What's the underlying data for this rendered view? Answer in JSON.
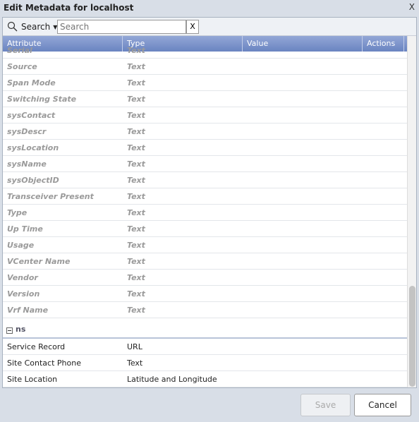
{
  "dialog": {
    "title": "Edit Metadata for localhost",
    "close": "X"
  },
  "toolbar": {
    "search_label": "Search",
    "search_placeholder": "Search",
    "clear": "X"
  },
  "columns": [
    "Attribute",
    "Type",
    "Value",
    "Actions"
  ],
  "inherited_rows": [
    {
      "attr": "Serial",
      "type": "Text"
    },
    {
      "attr": "Source",
      "type": "Text"
    },
    {
      "attr": "Span Mode",
      "type": "Text"
    },
    {
      "attr": "Switching State",
      "type": "Text"
    },
    {
      "attr": "sysContact",
      "type": "Text"
    },
    {
      "attr": "sysDescr",
      "type": "Text"
    },
    {
      "attr": "sysLocation",
      "type": "Text"
    },
    {
      "attr": "sysName",
      "type": "Text"
    },
    {
      "attr": "sysObjectID",
      "type": "Text"
    },
    {
      "attr": "Transceiver Present",
      "type": "Text"
    },
    {
      "attr": "Type",
      "type": "Text"
    },
    {
      "attr": "Up Time",
      "type": "Text"
    },
    {
      "attr": "Usage",
      "type": "Text"
    },
    {
      "attr": "VCenter Name",
      "type": "Text"
    },
    {
      "attr": "Vendor",
      "type": "Text"
    },
    {
      "attr": "Version",
      "type": "Text"
    },
    {
      "attr": "Vrf Name",
      "type": "Text"
    }
  ],
  "group": {
    "name": "ns",
    "rows": [
      {
        "attr": "Service Record",
        "type": "URL"
      },
      {
        "attr": "Site Contact Phone",
        "type": "Text"
      },
      {
        "attr": "Site Location",
        "type": "Latitude and Longitude"
      }
    ]
  },
  "scroll_position_percent": 92,
  "buttons": {
    "save": "Save",
    "cancel": "Cancel"
  }
}
